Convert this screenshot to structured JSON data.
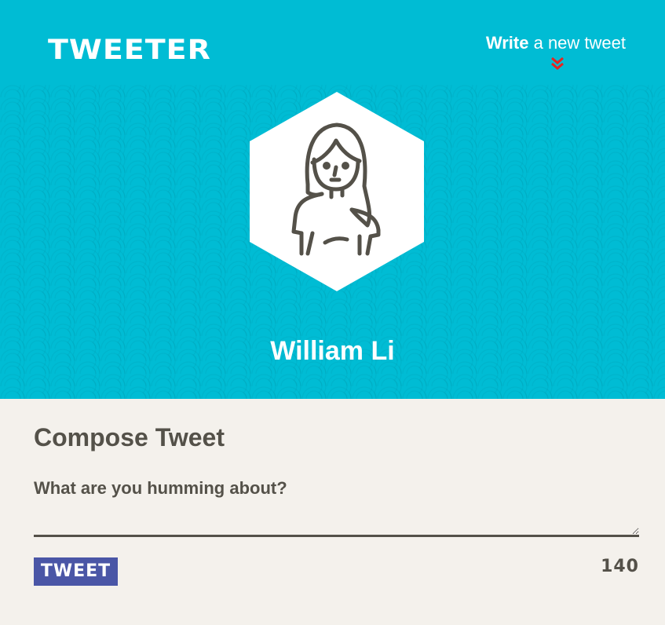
{
  "nav": {
    "brand": "TWEETER",
    "write_bold": "Write",
    "write_rest": " a new tweet",
    "icon": "double-chevron-down-icon",
    "icon_color": "#e8231f"
  },
  "profile": {
    "name": "William Li",
    "avatar_icon": "person-avatar-icon"
  },
  "compose": {
    "title": "Compose Tweet",
    "label": "What are you humming about?",
    "input_value": "",
    "button_label": "TWEET",
    "counter": "140"
  },
  "colors": {
    "header_bg": "#00bcd4",
    "page_bg": "#f4f1ec",
    "text": "#545149",
    "button_bg": "#4a56a6"
  }
}
